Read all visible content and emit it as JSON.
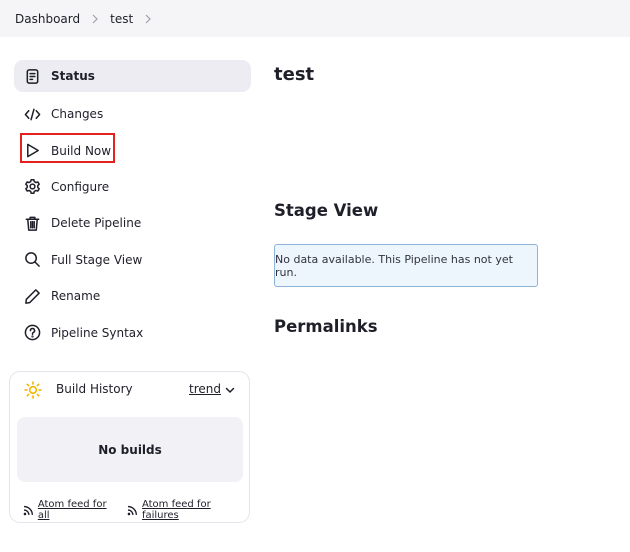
{
  "breadcrumb": {
    "items": [
      "Dashboard",
      "test"
    ]
  },
  "sidebar": {
    "items": [
      {
        "label": "Status",
        "icon": "document-icon",
        "active": true
      },
      {
        "label": "Changes",
        "icon": "code-icon"
      },
      {
        "label": "Build Now",
        "icon": "play-icon",
        "highlighted": true
      },
      {
        "label": "Configure",
        "icon": "gear-icon"
      },
      {
        "label": "Delete Pipeline",
        "icon": "trash-icon"
      },
      {
        "label": "Full Stage View",
        "icon": "search-icon"
      },
      {
        "label": "Rename",
        "icon": "pencil-icon"
      },
      {
        "label": "Pipeline Syntax",
        "icon": "help-icon"
      }
    ]
  },
  "build_history": {
    "title": "Build History",
    "trend_label": "trend",
    "empty_text": "No builds",
    "feed_all": "Atom feed for all",
    "feed_failures": "Atom feed for failures"
  },
  "main": {
    "title": "test",
    "stage_view_heading": "Stage View",
    "stage_view_message": "No data available. This Pipeline has not yet run.",
    "permalinks_heading": "Permalinks"
  },
  "colors": {
    "highlight": "#e3211f",
    "sun": "#f4b400",
    "info_bg": "#eef6fd",
    "info_border": "#8fb3d8"
  }
}
